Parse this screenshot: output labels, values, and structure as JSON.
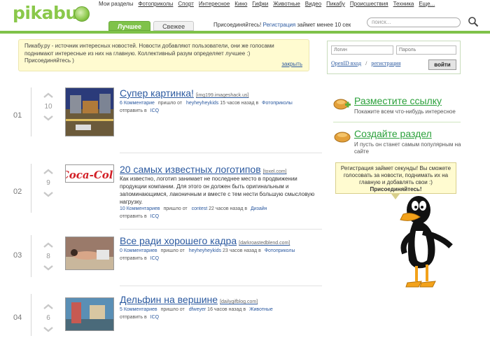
{
  "logo": {
    "text": "pikabu"
  },
  "topnav": [
    "Мои разделы",
    "Фотоприколы",
    "Спорт",
    "Интересное",
    "Кино",
    "Гифки",
    "Животные",
    "Видео",
    "Пикабу",
    "Происшествия",
    "Техника",
    "Еще..."
  ],
  "tabs": {
    "best": "Лучшее",
    "fresh": "Свежее"
  },
  "join": {
    "prefix": "Присоединяйтесь!",
    "link": "Регистрация",
    "suffix": "займет менее 10 сек"
  },
  "search": {
    "placeholder": "поиск..."
  },
  "info": {
    "line1": "Пикабу.ру - источник интересных новостей. Новости добавляют пользователи, они же голосами",
    "line2": "поднимают интересные из них на главную. Коллективный разум определяет лучшее :)",
    "line3": "Присоединяйтесь )",
    "close": "закрыть"
  },
  "login": {
    "login_placeholder": "Логин",
    "password_placeholder": "Пароль",
    "openid": "OpenID вход",
    "slash": "/",
    "register": "регистрация",
    "submit": "войти"
  },
  "posts": [
    {
      "rank": "01",
      "votes": "10",
      "title": "Супер картинка!",
      "source": "[img199.imageshack.us]",
      "desc": "",
      "comments": "6 Комментарие",
      "came_from": "пришло от",
      "author": "heyheyheykids",
      "time": "15 часов назад в",
      "category": "Фотоприколы",
      "send": "отправить в",
      "send_target": "ICQ"
    },
    {
      "rank": "02",
      "votes": "9",
      "title": "20 самых известных логотипов",
      "source": "[toxel.com]",
      "desc": "Как известно, логотип занимает не последнее место в продвижении продукции компании. Для этого он должен быть оригинальным и запоминающимся, лаконичным и вместе с тем нести большую смысловую нагрузку.",
      "comments": "10 Комментариев",
      "came_from": "пришло от",
      "author": "contest",
      "time": "22 часов назад в",
      "category": "Дизайн",
      "send": "отправить в",
      "send_target": "ICQ"
    },
    {
      "rank": "03",
      "votes": "8",
      "title": "Все ради хорошего кадра",
      "source": "[darkroastedblend.com]",
      "desc": "",
      "comments": "0 Комментариев",
      "came_from": "пришло от",
      "author": "heyheyheykids",
      "time": "23 часов назад в",
      "category": "Фотоприколы",
      "send": "отправить в",
      "send_target": "ICQ"
    },
    {
      "rank": "04",
      "votes": "6",
      "title": "Дельфин на вершине",
      "source": "[dailygifblog.com]",
      "desc": "",
      "comments": "5 Комментариев",
      "came_from": "пришло от",
      "author": "dfweyer",
      "time": "16 часов назад в",
      "category": "Животные",
      "send": "отправить в",
      "send_target": "ICQ"
    }
  ],
  "sidebar": {
    "post_link": {
      "title": "Разместите ссылку",
      "subtitle": "Покажите всем что-нибудь интересное"
    },
    "create_section": {
      "title": "Создайте раздел",
      "subtitle": "И пусть он станет самым популярным на сайте"
    },
    "bubble": {
      "text": "Регистрация займет секунды! Вы сможете голосовать за новости, поднимать их на главную и добавлять свои :)",
      "bold": "Присоединяйтесь!"
    }
  },
  "colors": {
    "brand_green": "#7fc24a",
    "link_blue": "#2c5aa0",
    "info_bg": "#fffbd0"
  }
}
